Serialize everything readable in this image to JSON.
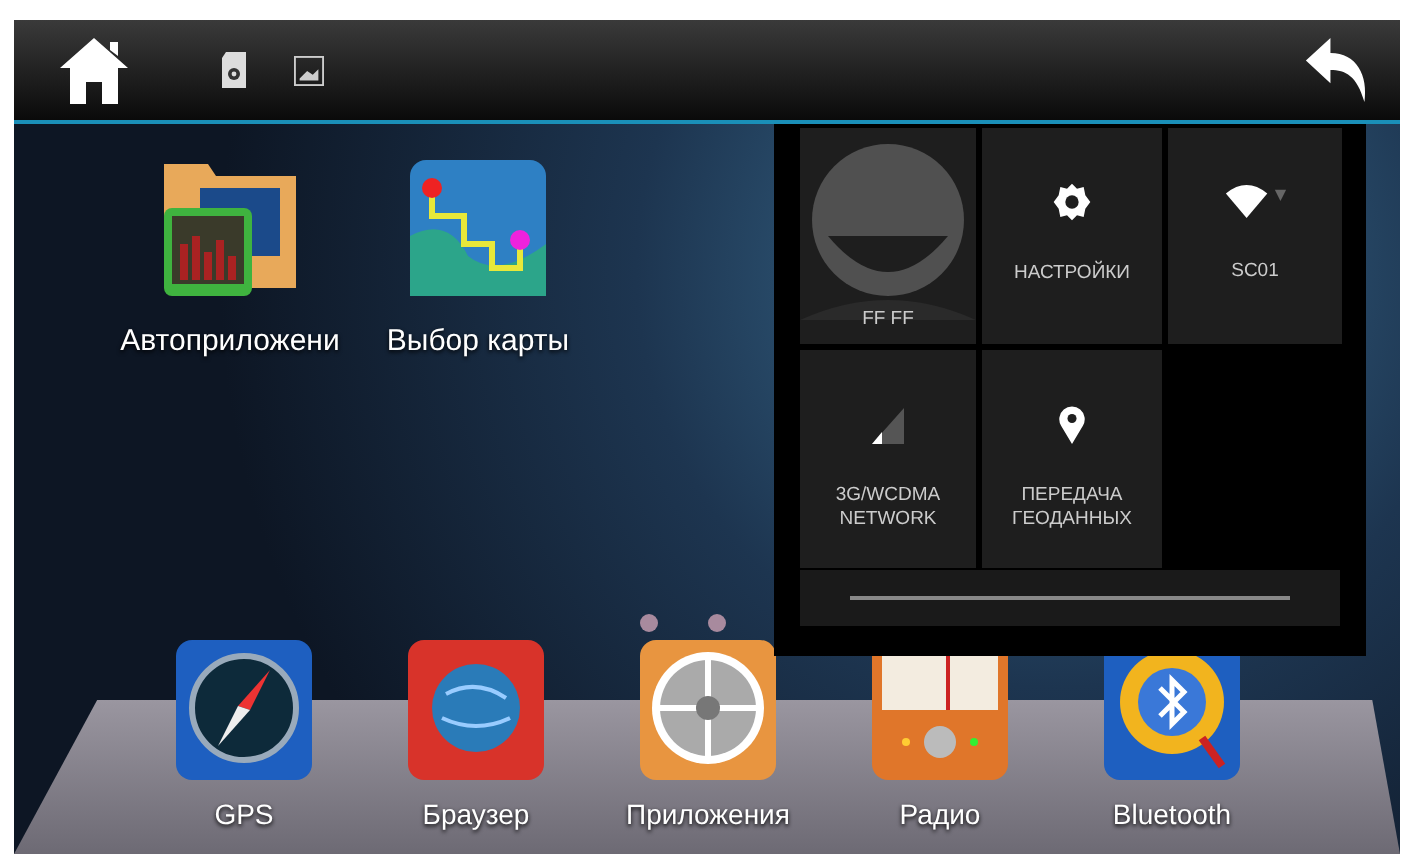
{
  "desktop_apps": [
    {
      "kind": "folder",
      "label": "Автоприложени"
    },
    {
      "kind": "map",
      "label": "Выбор карты"
    }
  ],
  "dock_apps": [
    {
      "kind": "compass",
      "label": "GPS"
    },
    {
      "kind": "globe",
      "label": "Браузер"
    },
    {
      "kind": "apps",
      "label": "Приложения"
    },
    {
      "kind": "radio",
      "label": "Радио"
    },
    {
      "kind": "bluetooth",
      "label": "Bluetooth"
    }
  ],
  "quick_settings": {
    "tiles": [
      {
        "kind": "user",
        "label": "FF FF"
      },
      {
        "kind": "settings",
        "label": "НАСТРОЙКИ"
      },
      {
        "kind": "wifi",
        "label": "SC01"
      },
      {
        "kind": "signal",
        "label": "3G/WCDMA NETWORK"
      },
      {
        "kind": "location",
        "label": "ПЕРЕДАЧА ГЕОДАННЫХ"
      }
    ],
    "brightness": {
      "level": 1
    }
  }
}
